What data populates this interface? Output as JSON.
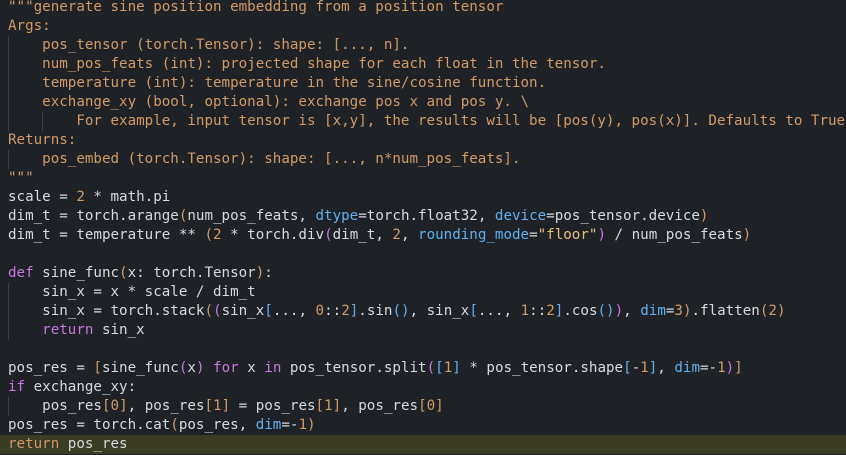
{
  "colors": {
    "background": "#1e2227",
    "current_line": "#3a3c24",
    "text": "#d7dae0",
    "docstring": "#d19a66",
    "keyword": "#c678dd",
    "number": "#d19a66",
    "string": "#e5c07b",
    "kwarg": "#61afef"
  },
  "code_lines": [
    {
      "indent": 0,
      "tokens": [
        {
          "t": "\"\"\"generate sine position embedding from a position tensor",
          "c": "doc"
        }
      ]
    },
    {
      "indent": 0,
      "tokens": [
        {
          "t": "Args:",
          "c": "doc"
        }
      ]
    },
    {
      "indent": 1,
      "tokens": [
        {
          "t": "    pos_tensor (torch.Tensor): shape: [..., n].",
          "c": "doc"
        }
      ]
    },
    {
      "indent": 1,
      "tokens": [
        {
          "t": "    num_pos_feats (int): projected shape for each float in the tensor.",
          "c": "doc"
        }
      ]
    },
    {
      "indent": 1,
      "tokens": [
        {
          "t": "    temperature (int): temperature in the sine/cosine function.",
          "c": "doc"
        }
      ]
    },
    {
      "indent": 1,
      "tokens": [
        {
          "t": "    exchange_xy (bool, optional): exchange pos x and pos y. \\",
          "c": "doc"
        }
      ]
    },
    {
      "indent": 2,
      "tokens": [
        {
          "t": "        For example, input tensor is [x,y], the results will be [pos(y), pos(x)]. Defaults to True.",
          "c": "doc"
        }
      ]
    },
    {
      "indent": 0,
      "tokens": [
        {
          "t": "Returns:",
          "c": "doc"
        }
      ]
    },
    {
      "indent": 1,
      "tokens": [
        {
          "t": "    pos_embed (torch.Tensor): shape: [..., n*num_pos_feats].",
          "c": "doc"
        }
      ]
    },
    {
      "indent": 0,
      "tokens": [
        {
          "t": "\"\"\"",
          "c": "doc"
        }
      ]
    },
    {
      "indent": 0,
      "tokens": [
        {
          "t": "scale = ",
          "c": "var"
        },
        {
          "t": "2",
          "c": "num"
        },
        {
          "t": " * math.pi",
          "c": "var"
        }
      ]
    },
    {
      "indent": 0,
      "tokens": [
        {
          "t": "dim_t = torch.arange",
          "c": "var"
        },
        {
          "t": "(",
          "c": "br1"
        },
        {
          "t": "num_pos_feats, ",
          "c": "var"
        },
        {
          "t": "dtype",
          "c": "kwa"
        },
        {
          "t": "=torch.float32, ",
          "c": "var"
        },
        {
          "t": "device",
          "c": "kwa"
        },
        {
          "t": "=pos_tensor.device",
          "c": "var"
        },
        {
          "t": ")",
          "c": "br1"
        }
      ]
    },
    {
      "indent": 0,
      "tokens": [
        {
          "t": "dim_t = temperature ** ",
          "c": "var"
        },
        {
          "t": "(",
          "c": "br1"
        },
        {
          "t": "2",
          "c": "num"
        },
        {
          "t": " * torch.div",
          "c": "var"
        },
        {
          "t": "(",
          "c": "br2"
        },
        {
          "t": "dim_t, ",
          "c": "var"
        },
        {
          "t": "2",
          "c": "num"
        },
        {
          "t": ", ",
          "c": "var"
        },
        {
          "t": "rounding_mode",
          "c": "kwa"
        },
        {
          "t": "=",
          "c": "var"
        },
        {
          "t": "\"floor\"",
          "c": "str"
        },
        {
          "t": ")",
          "c": "br2"
        },
        {
          "t": " / num_pos_feats",
          "c": "var"
        },
        {
          "t": ")",
          "c": "br1"
        }
      ]
    },
    {
      "indent": 0,
      "tokens": [
        {
          "t": "",
          "c": "var"
        }
      ]
    },
    {
      "indent": 0,
      "tokens": [
        {
          "t": "def",
          "c": "kw"
        },
        {
          "t": " sine_func",
          "c": "var"
        },
        {
          "t": "(",
          "c": "br1"
        },
        {
          "t": "x: torch.Tensor",
          "c": "var"
        },
        {
          "t": ")",
          "c": "br1"
        },
        {
          "t": ":",
          "c": "var"
        }
      ]
    },
    {
      "indent": 1,
      "tokens": [
        {
          "t": "    sin_x = x * scale / dim_t",
          "c": "var"
        }
      ]
    },
    {
      "indent": 1,
      "tokens": [
        {
          "t": "    sin_x = torch.stack",
          "c": "var"
        },
        {
          "t": "(",
          "c": "br1"
        },
        {
          "t": "(",
          "c": "br2"
        },
        {
          "t": "sin_x",
          "c": "var"
        },
        {
          "t": "[",
          "c": "br3"
        },
        {
          "t": "..., ",
          "c": "var"
        },
        {
          "t": "0",
          "c": "num"
        },
        {
          "t": "::",
          "c": "var"
        },
        {
          "t": "2",
          "c": "num"
        },
        {
          "t": "]",
          "c": "br3"
        },
        {
          "t": ".sin",
          "c": "var"
        },
        {
          "t": "()",
          "c": "br3"
        },
        {
          "t": ", sin_x",
          "c": "var"
        },
        {
          "t": "[",
          "c": "br3"
        },
        {
          "t": "..., ",
          "c": "var"
        },
        {
          "t": "1",
          "c": "num"
        },
        {
          "t": "::",
          "c": "var"
        },
        {
          "t": "2",
          "c": "num"
        },
        {
          "t": "]",
          "c": "br3"
        },
        {
          "t": ".cos",
          "c": "var"
        },
        {
          "t": "()",
          "c": "br3"
        },
        {
          "t": ")",
          "c": "br2"
        },
        {
          "t": ", ",
          "c": "var"
        },
        {
          "t": "dim",
          "c": "kwa"
        },
        {
          "t": "=",
          "c": "var"
        },
        {
          "t": "3",
          "c": "num"
        },
        {
          "t": ")",
          "c": "br1"
        },
        {
          "t": ".flatten",
          "c": "var"
        },
        {
          "t": "(",
          "c": "br1"
        },
        {
          "t": "2",
          "c": "num"
        },
        {
          "t": ")",
          "c": "br1"
        }
      ]
    },
    {
      "indent": 1,
      "tokens": [
        {
          "t": "    ",
          "c": "var"
        },
        {
          "t": "return",
          "c": "kw"
        },
        {
          "t": " sin_x",
          "c": "var"
        }
      ]
    },
    {
      "indent": 0,
      "tokens": [
        {
          "t": "",
          "c": "var"
        }
      ]
    },
    {
      "indent": 0,
      "tokens": [
        {
          "t": "pos_res = ",
          "c": "var"
        },
        {
          "t": "[",
          "c": "br1"
        },
        {
          "t": "sine_func",
          "c": "var"
        },
        {
          "t": "(",
          "c": "br2"
        },
        {
          "t": "x",
          "c": "var"
        },
        {
          "t": ")",
          "c": "br2"
        },
        {
          "t": " ",
          "c": "var"
        },
        {
          "t": "for",
          "c": "kw"
        },
        {
          "t": " x ",
          "c": "var"
        },
        {
          "t": "in",
          "c": "kw"
        },
        {
          "t": " pos_tensor.split",
          "c": "var"
        },
        {
          "t": "(",
          "c": "br2"
        },
        {
          "t": "[",
          "c": "br3"
        },
        {
          "t": "1",
          "c": "num"
        },
        {
          "t": "]",
          "c": "br3"
        },
        {
          "t": " * pos_tensor.shape",
          "c": "var"
        },
        {
          "t": "[",
          "c": "br3"
        },
        {
          "t": "-",
          "c": "var"
        },
        {
          "t": "1",
          "c": "num"
        },
        {
          "t": "]",
          "c": "br3"
        },
        {
          "t": ", ",
          "c": "var"
        },
        {
          "t": "dim",
          "c": "kwa"
        },
        {
          "t": "=-",
          "c": "var"
        },
        {
          "t": "1",
          "c": "num"
        },
        {
          "t": ")",
          "c": "br2"
        },
        {
          "t": "]",
          "c": "br1"
        }
      ]
    },
    {
      "indent": 0,
      "tokens": [
        {
          "t": "if",
          "c": "kw"
        },
        {
          "t": " exchange_xy:",
          "c": "var"
        }
      ]
    },
    {
      "indent": 1,
      "tokens": [
        {
          "t": "    pos_res",
          "c": "var"
        },
        {
          "t": "[",
          "c": "br1"
        },
        {
          "t": "0",
          "c": "num"
        },
        {
          "t": "]",
          "c": "br1"
        },
        {
          "t": ", pos_res",
          "c": "var"
        },
        {
          "t": "[",
          "c": "br1"
        },
        {
          "t": "1",
          "c": "num"
        },
        {
          "t": "]",
          "c": "br1"
        },
        {
          "t": " = pos_res",
          "c": "var"
        },
        {
          "t": "[",
          "c": "br1"
        },
        {
          "t": "1",
          "c": "num"
        },
        {
          "t": "]",
          "c": "br1"
        },
        {
          "t": ", pos_res",
          "c": "var"
        },
        {
          "t": "[",
          "c": "br1"
        },
        {
          "t": "0",
          "c": "num"
        },
        {
          "t": "]",
          "c": "br1"
        }
      ]
    },
    {
      "indent": 0,
      "tokens": [
        {
          "t": "pos_res = torch.cat",
          "c": "var"
        },
        {
          "t": "(",
          "c": "br1"
        },
        {
          "t": "pos_res, ",
          "c": "var"
        },
        {
          "t": "dim",
          "c": "kwa"
        },
        {
          "t": "=-",
          "c": "var"
        },
        {
          "t": "1",
          "c": "num"
        },
        {
          "t": ")",
          "c": "br1"
        }
      ]
    },
    {
      "indent": 0,
      "current": true,
      "tokens": [
        {
          "t": "return",
          "c": "kwr"
        },
        {
          "t": " pos_res",
          "c": "var"
        }
      ]
    }
  ]
}
